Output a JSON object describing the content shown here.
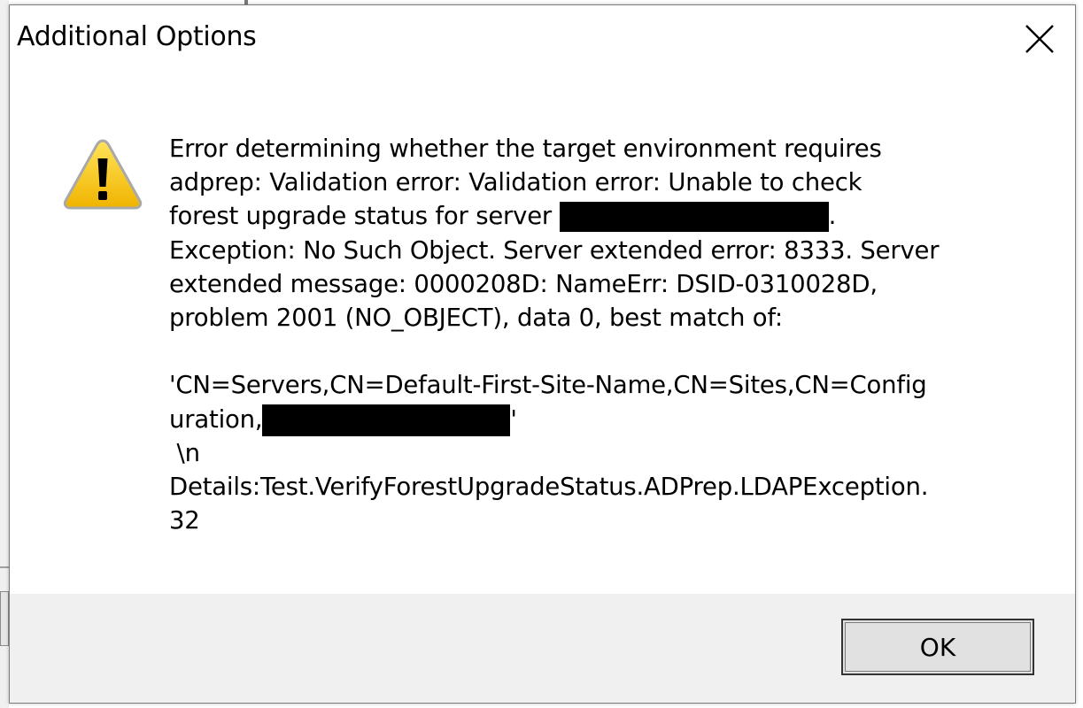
{
  "dialog": {
    "title": "Additional Options",
    "close_label": "Close",
    "icon": "warning-icon",
    "message": {
      "line1": "Error determining whether the target environment requires",
      "line2": "adprep: Validation error: Validation error: Unable to check",
      "line3_prefix": "forest upgrade status for server ",
      "line3_suffix": ".",
      "line4": "Exception: No Such Object. Server extended error: 8333. Server",
      "line5": "extended message: 0000208D: NameErr: DSID-0310028D,",
      "line6": "problem 2001 (NO_OBJECT), data 0, best match of:",
      "line7": "'CN=Servers,CN=Default-First-Site-Name,CN=Sites,CN=Config",
      "line8_prefix": "uration,",
      "line8_suffix": "'",
      "line9": " \\n",
      "line10": "Details:Test.VerifyForestUpgradeStatus.ADPrep.LDAPException.",
      "line11": "32"
    },
    "ok_label": "OK"
  },
  "colors": {
    "footer_bg": "#f0f0f0",
    "warning_yellow": "#f5c400",
    "redaction": "#000000"
  }
}
